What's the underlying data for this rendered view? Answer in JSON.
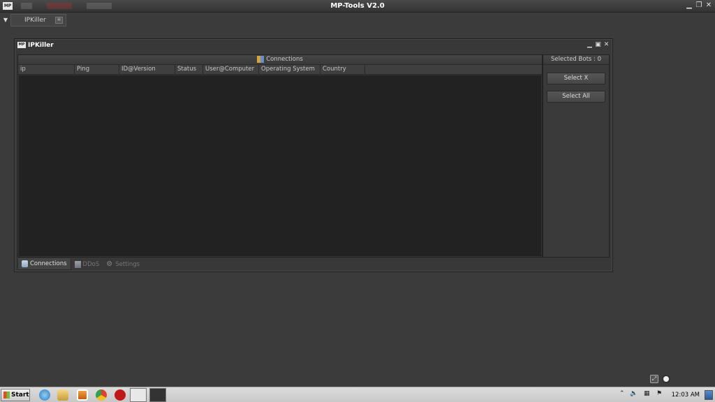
{
  "app": {
    "title": "MP-Tools V2.0",
    "logo_text": "MP"
  },
  "mdi": {
    "tab_label": "IPKiller"
  },
  "window": {
    "title": "IPKiller",
    "logo_text": "MP"
  },
  "connections": {
    "header": "Connections",
    "columns": [
      "ip",
      "Ping",
      "ID@Version",
      "Status",
      "User@Computer",
      "Operating System",
      "Country"
    ]
  },
  "side": {
    "selected_bots": "Selected Bots : 0",
    "select_x": "Select X",
    "select_all": "Select All"
  },
  "tabs": [
    {
      "label": "Connections",
      "icon": "database-icon",
      "active": true
    },
    {
      "label": "DDoS",
      "icon": "document-icon",
      "active": false
    },
    {
      "label": "Settings",
      "icon": "gear-icon",
      "active": false
    }
  ],
  "taskbar": {
    "start_label": "Start",
    "clock": "12:03 AM"
  }
}
